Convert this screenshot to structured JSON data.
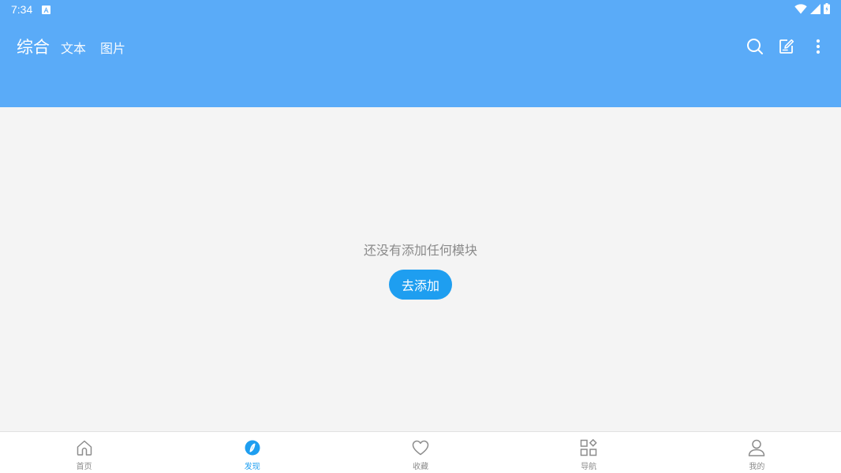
{
  "status_bar": {
    "time": "7:34",
    "icons": [
      "android-a-icon",
      "wifi-icon",
      "signal-icon",
      "battery-icon"
    ]
  },
  "app_bar": {
    "tabs": [
      {
        "label": "综合",
        "active": true
      },
      {
        "label": "文本",
        "active": false
      },
      {
        "label": "图片",
        "active": false
      }
    ],
    "actions": [
      "search-icon",
      "edit-icon",
      "more-vert-icon"
    ]
  },
  "content": {
    "empty_message": "还没有添加任何模块",
    "add_button_label": "去添加"
  },
  "bottom_nav": {
    "items": [
      {
        "label": "首页",
        "icon": "home-icon",
        "active": false
      },
      {
        "label": "发现",
        "icon": "compass-icon",
        "active": true
      },
      {
        "label": "收藏",
        "icon": "heart-icon",
        "active": false
      },
      {
        "label": "导航",
        "icon": "grid-icon",
        "active": false
      },
      {
        "label": "我的",
        "icon": "person-icon",
        "active": false
      }
    ]
  },
  "colors": {
    "primary": "#5aabf8",
    "accent": "#1e9ef0",
    "background": "#f4f4f4",
    "nav_inactive": "#8c8c8c"
  }
}
